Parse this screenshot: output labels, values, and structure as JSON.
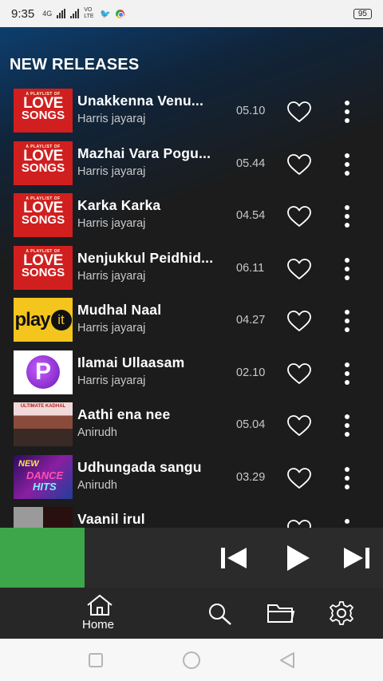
{
  "status_bar": {
    "time": "9:35",
    "network": "4G",
    "volte": "VO LTE",
    "battery": "95"
  },
  "section_title": "NEW RELEASES",
  "tracks": [
    {
      "title": "Unakkenna Venu...",
      "artist": "Harris jayaraj",
      "duration": "05.10",
      "art": "love-songs"
    },
    {
      "title": "Mazhai Vara Pogu...",
      "artist": "Harris jayaraj",
      "duration": "05.44",
      "art": "love-songs"
    },
    {
      "title": "Karka Karka",
      "artist": "Harris jayaraj",
      "duration": "04.54",
      "art": "love-songs"
    },
    {
      "title": "Nenjukkul Peidhid...",
      "artist": "Harris jayaraj",
      "duration": "06.11",
      "art": "love-songs"
    },
    {
      "title": "Mudhal Naal",
      "artist": "Harris jayaraj",
      "duration": "04.27",
      "art": "play-it"
    },
    {
      "title": "Ilamai Ullaasam",
      "artist": "Harris jayaraj",
      "duration": "02.10",
      "art": "purple-p"
    },
    {
      "title": "Aathi ena nee",
      "artist": "Anirudh",
      "duration": "05.04",
      "art": "ultimate-kadhal"
    },
    {
      "title": "Udhungada sangu",
      "artist": "Anirudh",
      "duration": "03.29",
      "art": "dance-hits"
    },
    {
      "title": "Vaanil irul",
      "artist": "",
      "duration": "",
      "art": "partial"
    }
  ],
  "album_art_text": {
    "love_top": "A PLAYLIST OF",
    "love_word": "LOVE",
    "songs_word": "SONGS",
    "play": "play",
    "it": "it",
    "purple_letter": "P",
    "ultimate": "ULTIMATE KADHAL",
    "new": "NEW",
    "dance": "DANCE",
    "hits": "HITS"
  },
  "player": {
    "progress_fraction": 0.22,
    "progress_color": "#3ea64a"
  },
  "bottom_nav": {
    "home_label": "Home",
    "items": [
      "home-icon",
      "search-icon",
      "folder-icon",
      "gear-icon"
    ]
  },
  "colors": {
    "accent": "#3ea64a",
    "background": "#1c1c1c",
    "header_gradient": "#0d3e6e"
  }
}
